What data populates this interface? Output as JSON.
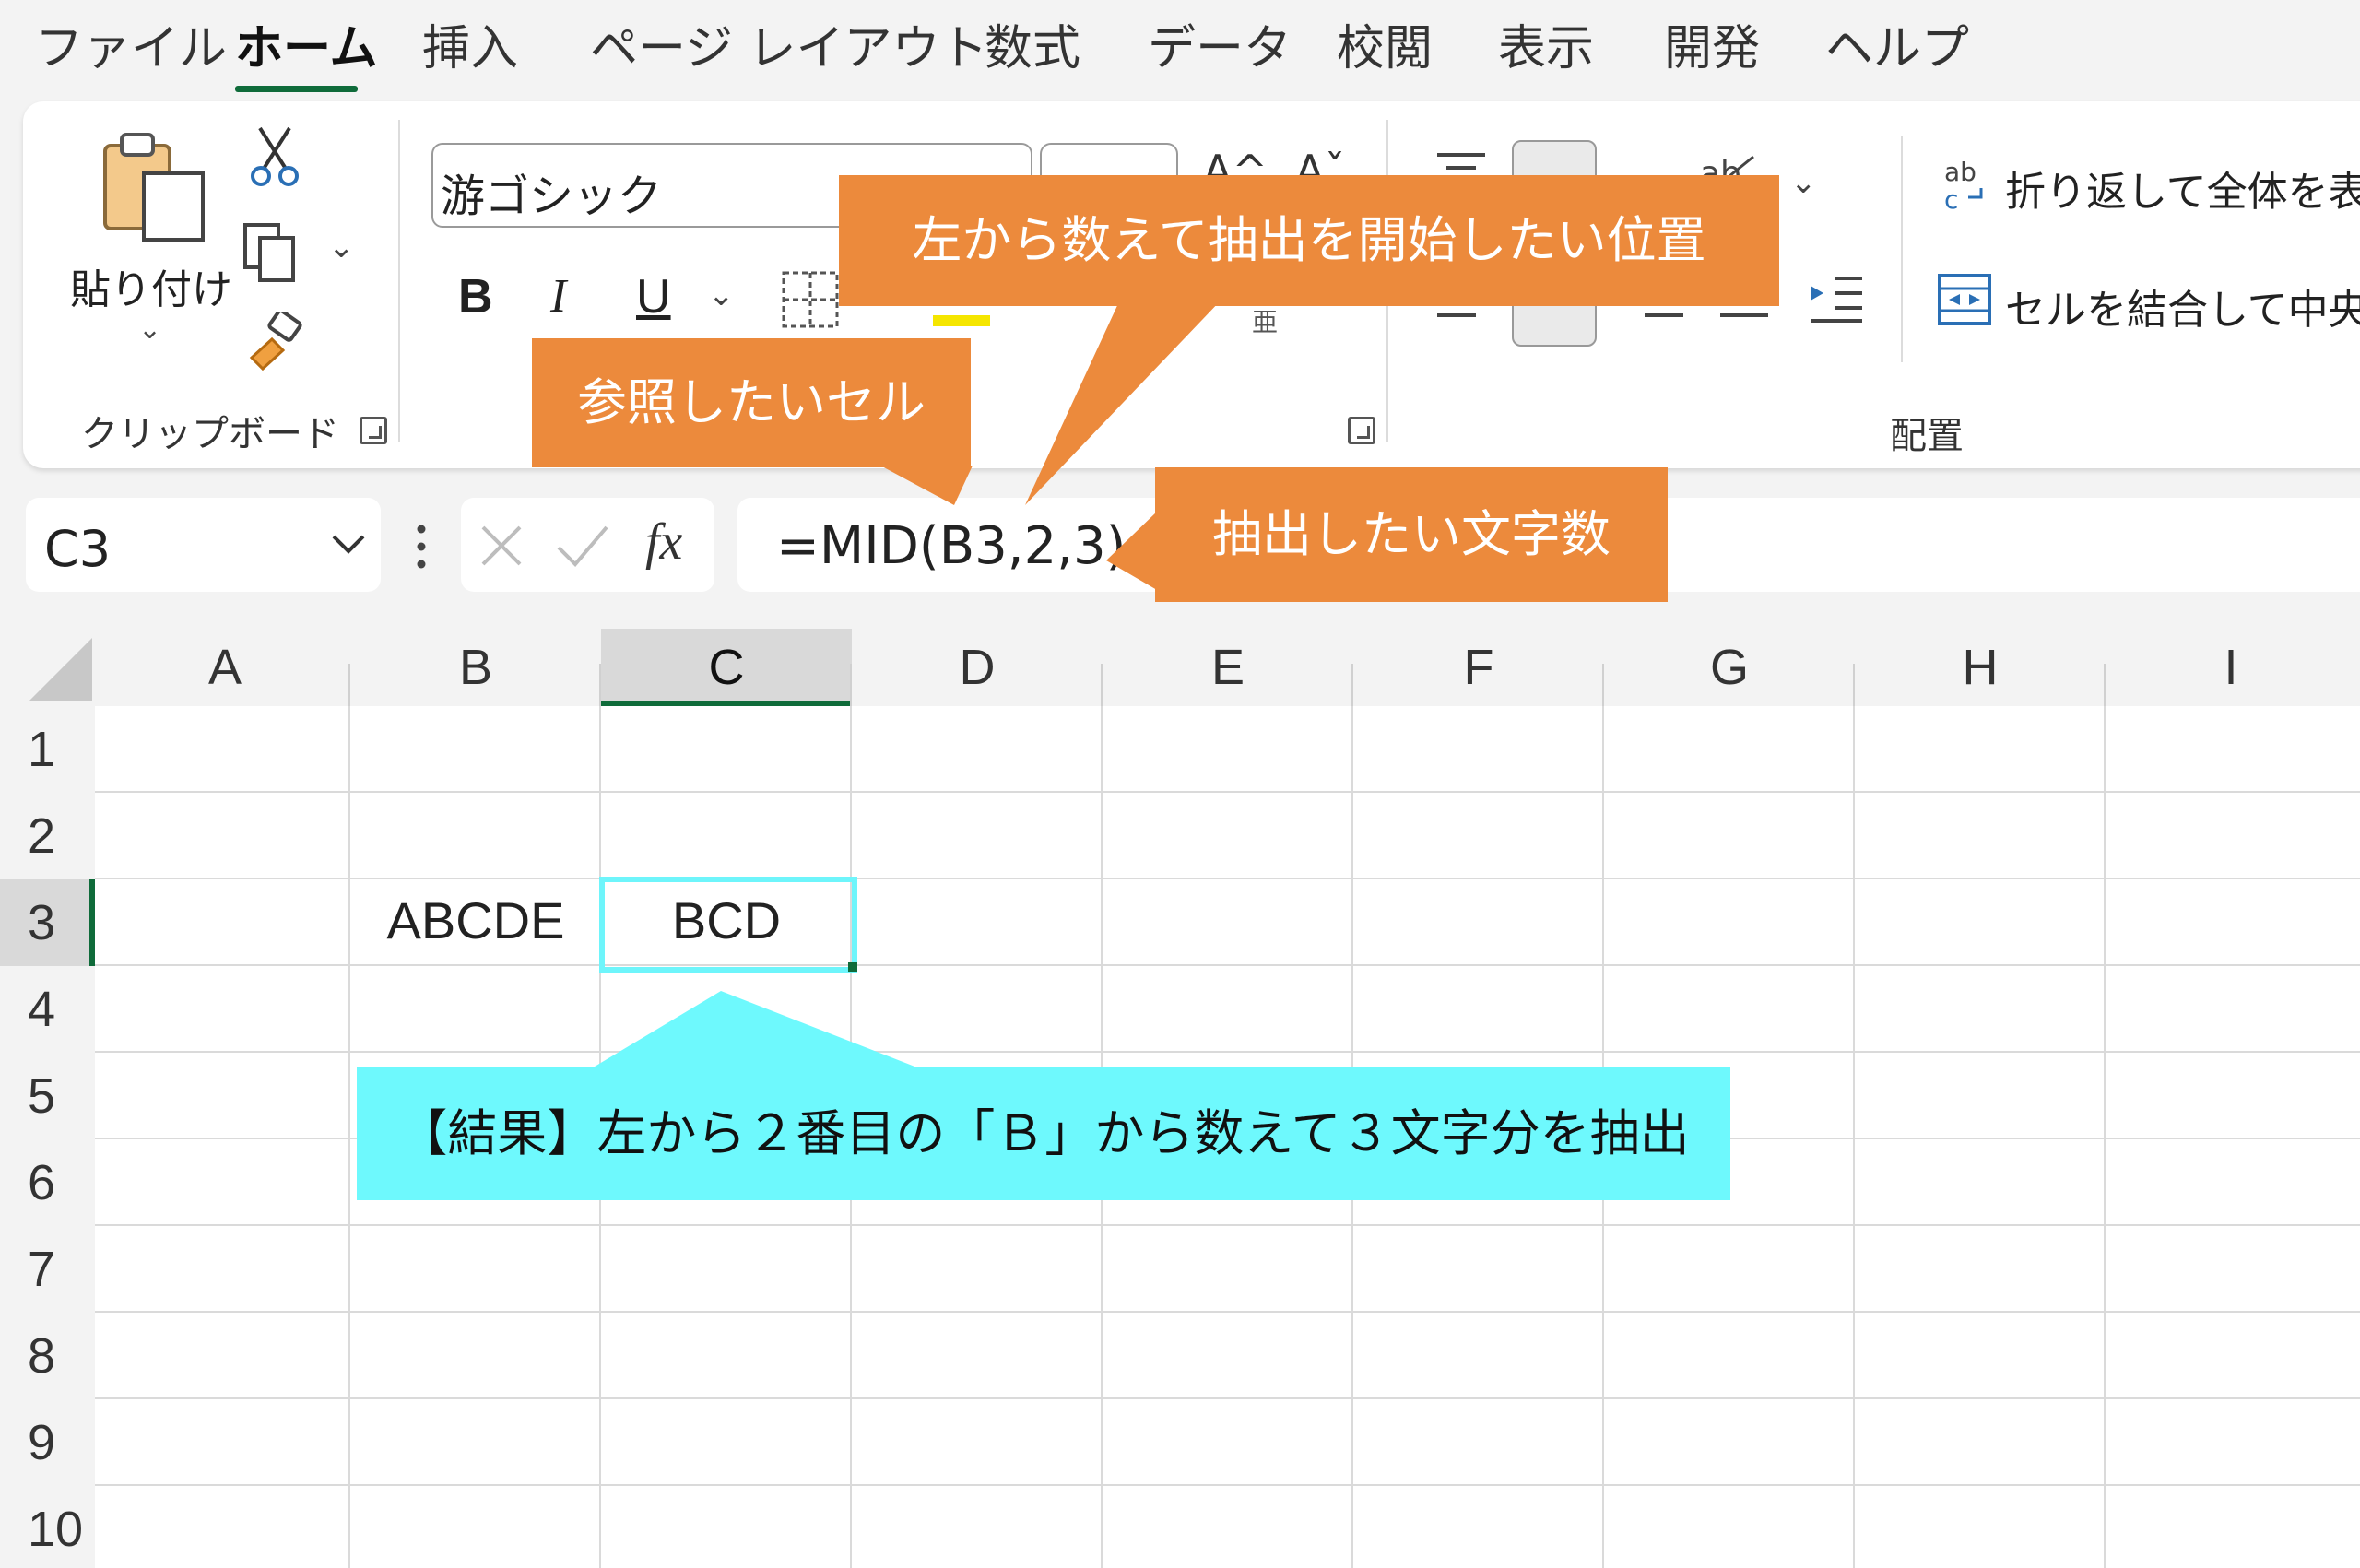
{
  "menu": {
    "tabs": [
      {
        "label": "ファイル"
      },
      {
        "label": "ホーム",
        "active": true
      },
      {
        "label": "挿入"
      },
      {
        "label": "ページ レイアウト"
      },
      {
        "label": "数式"
      },
      {
        "label": "データ"
      },
      {
        "label": "校閲"
      },
      {
        "label": "表示"
      },
      {
        "label": "開発"
      },
      {
        "label": "ヘルプ"
      }
    ]
  },
  "ribbon": {
    "clipboard": {
      "paste_label": "貼り付け",
      "group_label": "クリップボード"
    },
    "font": {
      "font_name": "游ゴシック",
      "bold": "B",
      "italic": "I",
      "underline": "U"
    },
    "alignment": {
      "wrap_text": "折り返して全体を表示",
      "merge_center": "セルを結合して中央揃え",
      "group_label": "配置"
    }
  },
  "formula_bar": {
    "name_box": "C3",
    "fx_label": "fx",
    "formula": "=MID(B3,2,3)"
  },
  "sheet": {
    "columns": [
      "A",
      "B",
      "C",
      "D",
      "E",
      "F",
      "G",
      "H",
      "I"
    ],
    "rows": [
      "1",
      "2",
      "3",
      "4",
      "5",
      "6",
      "7",
      "8",
      "9",
      "10"
    ],
    "selected_column": "C",
    "selected_row": "3",
    "cells": {
      "B3": "ABCDE",
      "C3": "BCD"
    }
  },
  "callouts": {
    "start_position": "左から数えて抽出を開始したい位置",
    "ref_cell": "参照したいセル",
    "num_chars": "抽出したい文字数",
    "result": "【結果】左から２番目の「Ｂ」から数えて３文字分を抽出"
  },
  "colors": {
    "accent_green": "#0f6b3a",
    "callout_orange": "#ec8a3c",
    "callout_cyan": "#6ef9fd"
  }
}
